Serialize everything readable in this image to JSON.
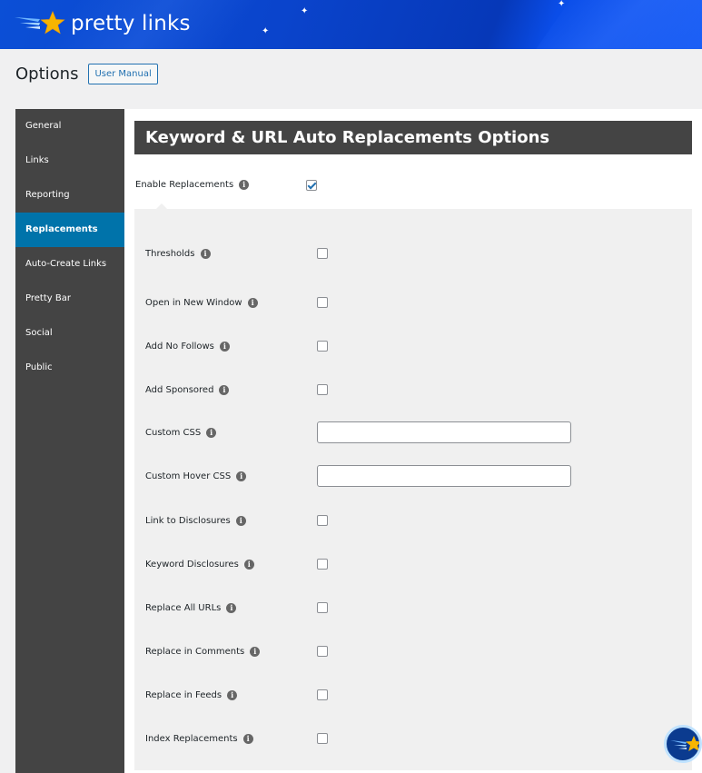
{
  "brand": {
    "name": "pretty links",
    "colors": {
      "banner": "#0a44cc",
      "accent": "#0073aa",
      "star": "#f7b500"
    }
  },
  "header": {
    "title": "Options",
    "manual_button": "User Manual"
  },
  "sidebar": {
    "items": [
      {
        "label": "General",
        "active": false
      },
      {
        "label": "Links",
        "active": false
      },
      {
        "label": "Reporting",
        "active": false
      },
      {
        "label": "Replacements",
        "active": true
      },
      {
        "label": "Auto-Create Links",
        "active": false
      },
      {
        "label": "Pretty Bar",
        "active": false
      },
      {
        "label": "Social",
        "active": false
      },
      {
        "label": "Public",
        "active": false
      }
    ]
  },
  "main": {
    "section_title": "Keyword & URL Auto Replacements Options",
    "enable": {
      "label": "Enable Replacements",
      "checked": true,
      "icon": "info-icon"
    },
    "options": [
      {
        "label": "Thresholds",
        "type": "checkbox",
        "checked": false
      },
      {
        "label": "Open in New Window",
        "type": "checkbox",
        "checked": false
      },
      {
        "label": "Add No Follows",
        "type": "checkbox",
        "checked": false
      },
      {
        "label": "Add Sponsored",
        "type": "checkbox",
        "checked": false
      },
      {
        "label": "Custom CSS",
        "type": "text",
        "value": ""
      },
      {
        "label": "Custom Hover CSS",
        "type": "text",
        "value": ""
      },
      {
        "label": "Link to Disclosures",
        "type": "checkbox",
        "checked": false
      },
      {
        "label": "Keyword Disclosures",
        "type": "checkbox",
        "checked": false
      },
      {
        "label": "Replace All URLs",
        "type": "checkbox",
        "checked": false
      },
      {
        "label": "Replace in Comments",
        "type": "checkbox",
        "checked": false
      },
      {
        "label": "Replace in Feeds",
        "type": "checkbox",
        "checked": false
      },
      {
        "label": "Index Replacements",
        "type": "checkbox",
        "checked": false
      }
    ]
  },
  "icons": {
    "info": "i",
    "sparkle": "✦"
  }
}
